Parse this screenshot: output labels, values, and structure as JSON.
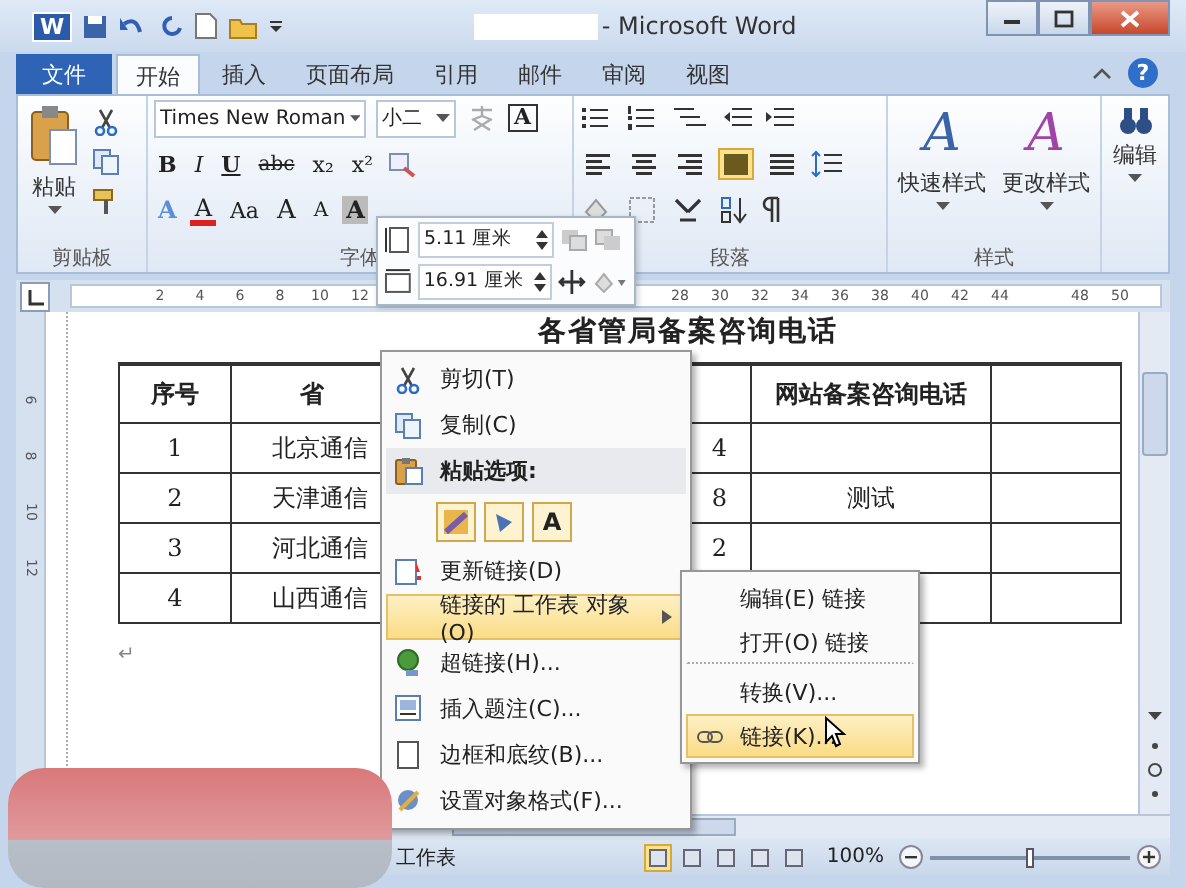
{
  "window": {
    "logo_letter": "W",
    "title": "- Microsoft Word"
  },
  "tabs": [
    {
      "label": "文件",
      "kind": "file",
      "selected": false
    },
    {
      "label": "开始",
      "kind": "tab",
      "selected": true
    },
    {
      "label": "插入",
      "kind": "tab",
      "selected": false
    },
    {
      "label": "页面布局",
      "kind": "tab",
      "selected": false
    },
    {
      "label": "引用",
      "kind": "tab",
      "selected": false
    },
    {
      "label": "邮件",
      "kind": "tab",
      "selected": false
    },
    {
      "label": "审阅",
      "kind": "tab",
      "selected": false
    },
    {
      "label": "视图",
      "kind": "tab",
      "selected": false
    }
  ],
  "help": "?",
  "ribbon": {
    "clipboard": {
      "paste_label": "粘贴",
      "group_label": "剪贴板"
    },
    "font": {
      "font_name": "Times New Roman",
      "font_size": "小二",
      "border_button": "A",
      "format_buttons": [
        {
          "label": "B",
          "kind": "bold"
        },
        {
          "label": "I",
          "kind": "italic"
        },
        {
          "label": "U",
          "kind": "underline"
        },
        {
          "label": "abc",
          "kind": "strike"
        },
        {
          "label": "x₂",
          "kind": "sub"
        },
        {
          "label": "x²",
          "kind": "sup"
        }
      ],
      "effect_buttons": [
        {
          "label": "A",
          "kind": "text-effect"
        },
        {
          "label": "A",
          "kind": "font-color"
        },
        {
          "label": "Aa",
          "kind": "case"
        },
        {
          "label": "A",
          "kind": "grow"
        },
        {
          "label": "A",
          "kind": "shrink"
        },
        {
          "label": "A",
          "kind": "shading"
        }
      ],
      "group_label": "字体"
    },
    "paragraph": {
      "alignments": [
        {
          "kind": "left",
          "selected": false
        },
        {
          "kind": "center",
          "selected": false
        },
        {
          "kind": "right",
          "selected": false
        },
        {
          "kind": "justify",
          "selected": true
        },
        {
          "kind": "distributed",
          "selected": false
        }
      ],
      "group_label": "段落"
    },
    "styles": {
      "buttons": [
        {
          "label": "快速样式",
          "glyph": "A"
        },
        {
          "label": "更改样式",
          "glyph": "A"
        }
      ],
      "group_label": "样式"
    },
    "editing": {
      "label": "编辑"
    }
  },
  "mini_toolbar": {
    "height": "5.11 厘米",
    "width": "16.91 厘米"
  },
  "ruler": {
    "ticks": [
      "2",
      "4",
      "6",
      "8",
      "10",
      "12",
      "28",
      "30",
      "32",
      "34",
      "36",
      "38",
      "40",
      "42",
      "44",
      "48",
      "50"
    ],
    "vertical_ticks": [
      "6",
      "8",
      "10",
      "12"
    ]
  },
  "document": {
    "title": "各省管局备案咨询电话",
    "table": {
      "headings": {
        "column_1": "序号",
        "column_2": "省",
        "column_4": "网站备案咨询电话"
      },
      "rows": [
        {
          "column_1": "1",
          "column_2": "北京通信",
          "column_3": "4"
        },
        {
          "column_1": "2",
          "column_2": "天津通信",
          "column_3": "8",
          "column_4": "测试"
        },
        {
          "column_1": "3",
          "column_2": "河北通信",
          "column_3": "2"
        },
        {
          "column_1": "4",
          "column_2": "山西通信"
        }
      ]
    },
    "paragraph_mark": "↵"
  },
  "context_menu": {
    "items": [
      {
        "kind": "command",
        "label": "剪切(T)",
        "selected": false
      },
      {
        "kind": "command",
        "label": "复制(C)",
        "selected": false
      },
      {
        "kind": "header",
        "label": "粘贴选项:",
        "selected": false
      },
      {
        "kind": "paste-options",
        "selected": false
      },
      {
        "kind": "command",
        "label": "更新链接(D)",
        "selected": false
      },
      {
        "kind": "submenu",
        "label": "链接的 工作表 对象(O)",
        "selected": true
      },
      {
        "kind": "command",
        "label": "超链接(H)...",
        "selected": false
      },
      {
        "kind": "command",
        "label": "插入题注(C)...",
        "selected": false
      },
      {
        "kind": "command",
        "label": "边框和底纹(B)...",
        "selected": false
      },
      {
        "kind": "command",
        "label": "设置对象格式(F)...",
        "selected": false
      }
    ],
    "paste_options": [
      {
        "kind": "keep-formatting"
      },
      {
        "kind": "merge-formatting"
      },
      {
        "kind": "text-only",
        "label": "A"
      }
    ],
    "submenu": [
      {
        "label": "编辑(E) 链接",
        "selected": false,
        "separator_after": false
      },
      {
        "label": "打开(O) 链接",
        "selected": false,
        "separator_after": true
      },
      {
        "label": "转换(V)...",
        "selected": false,
        "separator_after": false
      },
      {
        "label": "链接(K)...",
        "selected": true,
        "separator_after": false
      }
    ]
  },
  "status_bar": {
    "sheet_label": "工作表",
    "views": [
      {
        "selected": true
      },
      {
        "selected": false
      },
      {
        "selected": false
      },
      {
        "selected": false
      },
      {
        "selected": false
      }
    ],
    "zoom": {
      "label": "100%",
      "level": 0.5
    }
  }
}
